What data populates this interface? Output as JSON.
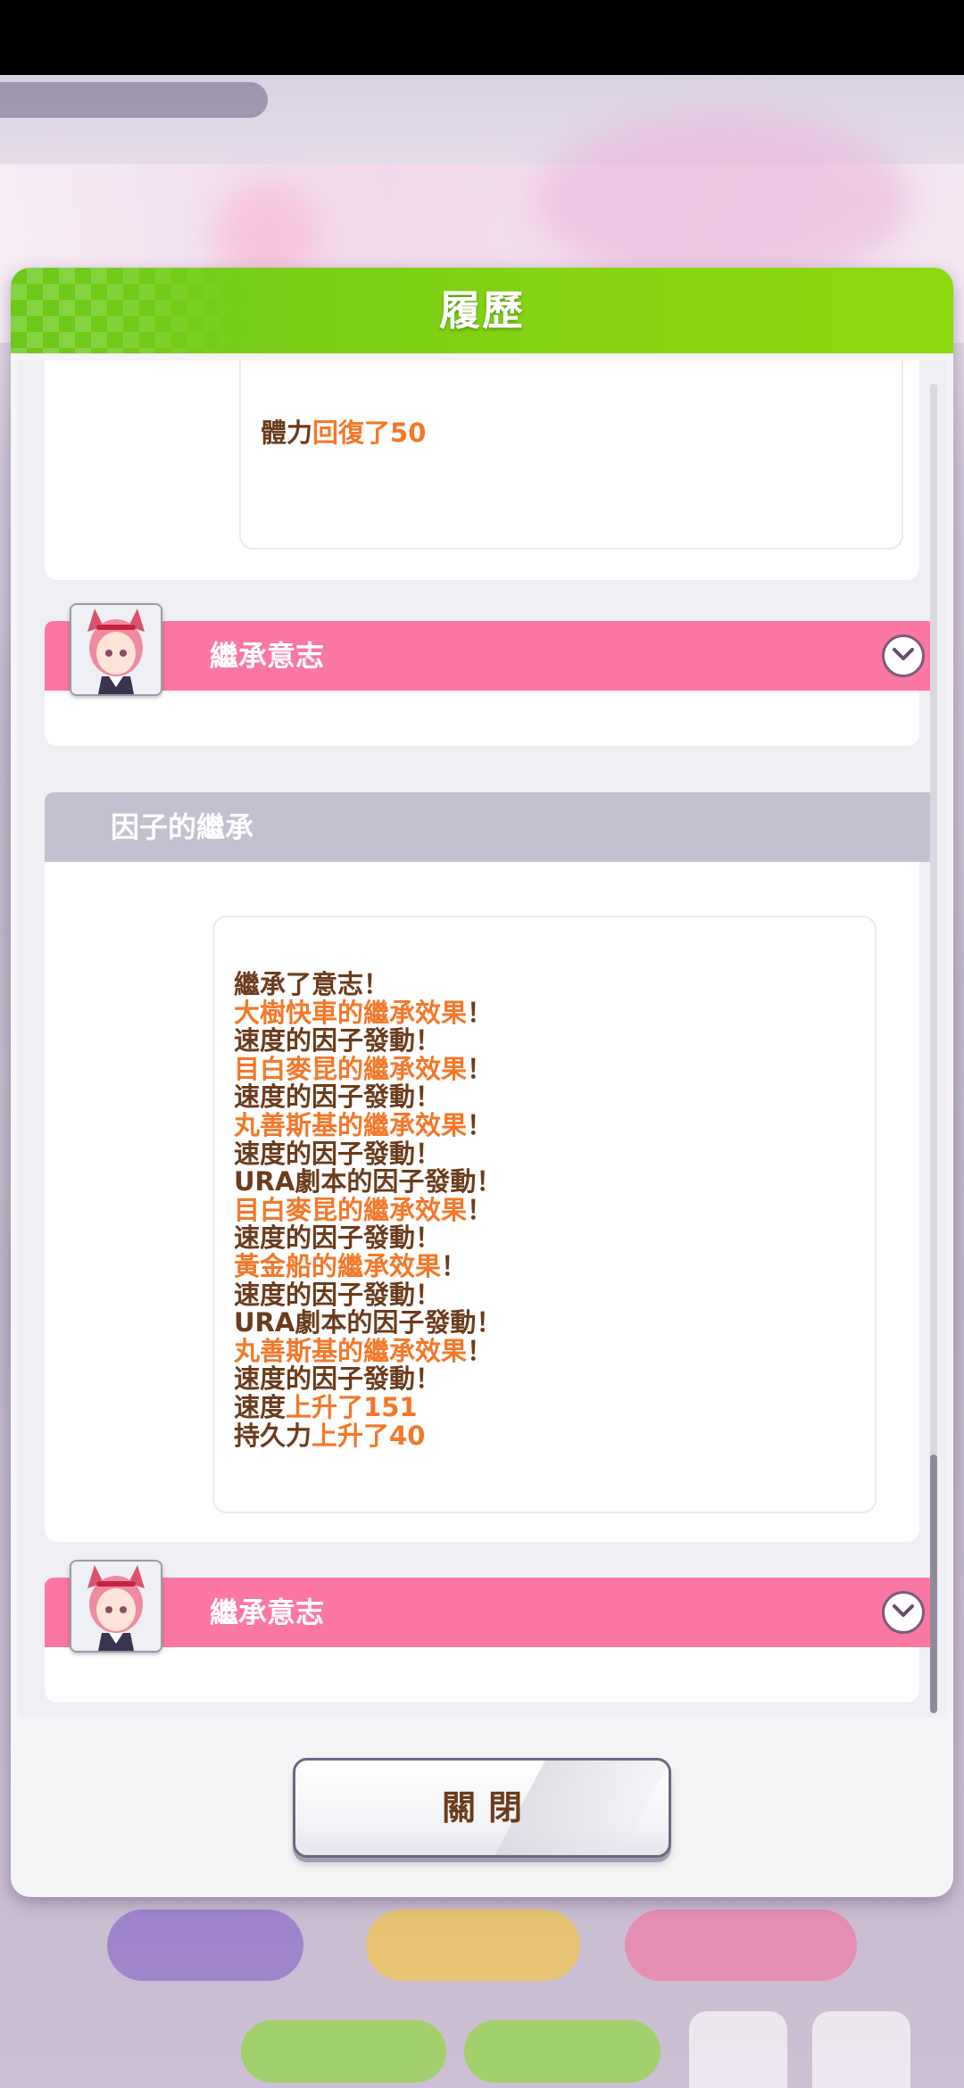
{
  "modal": {
    "title": "履歷",
    "close_label": "關閉"
  },
  "entries": {
    "stamina": {
      "prefix": "體力",
      "highlight": "回復了50"
    },
    "inherit_header_1": "繼承意志",
    "factor_section": {
      "header": "因子的繼承",
      "lines": [
        {
          "text": "繼承了意志！",
          "highlight": false
        },
        {
          "text": "大樹快車的繼承效果",
          "suffix": "！",
          "highlight": true
        },
        {
          "text": "速度的因子發動！",
          "highlight": false
        },
        {
          "text": "目白麥昆的繼承效果",
          "suffix": "！",
          "highlight": true
        },
        {
          "text": "速度的因子發動！",
          "highlight": false
        },
        {
          "text": "丸善斯基的繼承效果",
          "suffix": "！",
          "highlight": true
        },
        {
          "text": "速度的因子發動！",
          "highlight": false
        },
        {
          "text": "URA劇本的因子發動！",
          "highlight": false
        },
        {
          "text": "目白麥昆的繼承效果",
          "suffix": "！",
          "highlight": true
        },
        {
          "text": "速度的因子發動！",
          "highlight": false
        },
        {
          "text": "黃金船的繼承效果",
          "suffix": "！",
          "highlight": true
        },
        {
          "text": "速度的因子發動！",
          "highlight": false
        },
        {
          "text": "URA劇本的因子發動！",
          "highlight": false
        },
        {
          "text": "丸善斯基的繼承效果",
          "suffix": "！",
          "highlight": true
        },
        {
          "text": "速度的因子發動！",
          "highlight": false
        }
      ],
      "speed_prefix": "速度",
      "speed_highlight": "上升了151",
      "stamina_prefix": "持久力",
      "stamina_highlight": "上升了40"
    },
    "inherit_header_2": "繼承意志"
  },
  "colors": {
    "header_green": "#86d413",
    "pink": "#fb77a3",
    "brown_text": "#6b3c1c",
    "orange_text": "#f3782a",
    "grey_header": "#c2c1cf"
  },
  "icons": [
    "chevron-down-icon",
    "character-avatar"
  ]
}
